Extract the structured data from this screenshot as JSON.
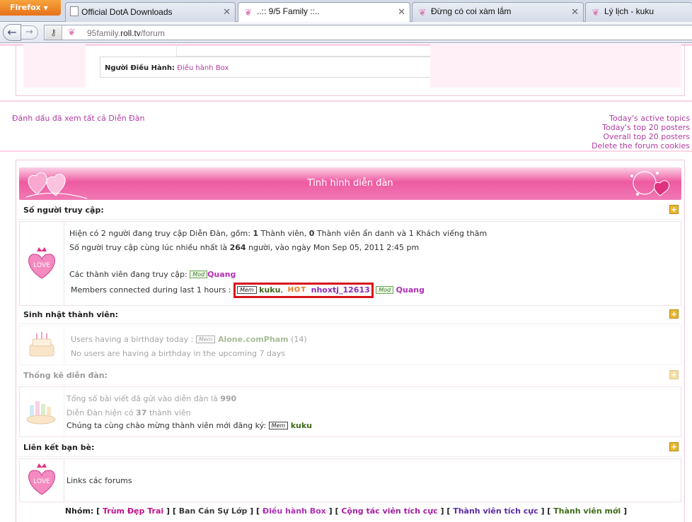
{
  "browser": {
    "menu_button": "Firefox",
    "tabs": [
      {
        "title": "Official DotA Downloads",
        "icon": "document-icon"
      },
      {
        "title": "..:: 9/5 Family ::..",
        "icon": "butterfly-icon",
        "active": true
      },
      {
        "title": "Đừng có coi xàm lắm",
        "icon": "butterfly-icon"
      },
      {
        "title": "Lý lịch - kuku",
        "icon": "butterfly-icon"
      }
    ],
    "url_domain": "95family.",
    "url_host": "roll.tv",
    "url_path": "/forum"
  },
  "moderator": {
    "label": "Người Điều Hành:",
    "value": "Điều hành Box"
  },
  "links": {
    "mark_read": "Đánh dấu đã xem tất cả Diễn Đàn",
    "today_active": "Today's active topics",
    "today_top": "Today's top 20 posters",
    "overall_top": "Overall top 20 posters",
    "delete_cookies": "Delete the forum cookies"
  },
  "stats": {
    "header": "Tình hình diễn đàn",
    "online": {
      "title": "Số người truy cập:",
      "line1_pre": "Hiện có 2 người đang truy cập Diễn Đàn, gồm: ",
      "line1_n1": "1",
      "line1_mid": " Thành viên, ",
      "line1_n2": "0",
      "line1_post": " Thành viên ẩn danh và 1 Khách viếng thăm",
      "line2_pre": "Số người truy cập cùng lúc nhiều nhất là ",
      "line2_n": "264",
      "line2_post": " người, vào ngày Mon Sep 05, 2011 2:45 pm",
      "online_label": "Các thành viên đang truy cập:",
      "online_user": "Quang",
      "last_hour_label": "Members connected during last 1 hours :",
      "badge_mem": "Mem",
      "badge_mod": "Mod",
      "badge_hot": "HOT",
      "user1": "kuku",
      "user2": "nhoxtj_12613",
      "user3": "Quang"
    },
    "birthday": {
      "title": "Sinh nhật thành viên:",
      "today_label": "Users having a birthday today :",
      "today_user": "Alone.comPham",
      "today_age": "(14)",
      "upcoming": "No users are having a birthday in the upcoming 7 days"
    },
    "forum_stats": {
      "title": "Thống kê diễn đàn:",
      "posts_pre": "Tổng số bài viết đã gửi vào diễn đàn là ",
      "posts_n": "990",
      "members_pre": "Diễn Đàn hiện có ",
      "members_n": "37",
      "members_post": " thành viên",
      "newest_label": "Chúng ta cùng chào mừng thành viên mới đăng ký:",
      "newest_user": "kuku"
    },
    "friends": {
      "title": "Liên kết bạn bè:",
      "text": "Links các forums"
    }
  },
  "groups": {
    "label": "Nhóm:",
    "items": [
      "Trùm Đẹp Trai",
      "Ban Cán Sự Lớp",
      "Điều hành Box",
      "Cộng tác viên tích cực",
      "Thành viên tích cực",
      "Thành viên mới"
    ]
  },
  "colors": {
    "pink_header": "#ee5aa1",
    "highlight_box": "#d8141c"
  }
}
